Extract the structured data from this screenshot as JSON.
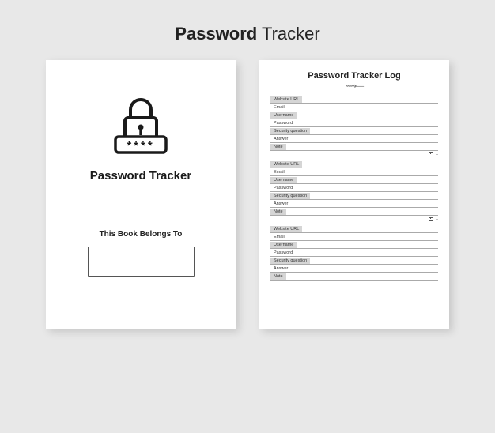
{
  "title": {
    "bold": "Password",
    "light": " Tracker"
  },
  "cover": {
    "icon_name": "padlock-password-icon",
    "title": "Password Tracker",
    "belongs_to": "This Book Belongs To"
  },
  "log": {
    "title": "Password Tracker Log",
    "swirl": "⟿—",
    "fields": [
      {
        "label": "Website URL",
        "shaded": true
      },
      {
        "label": "Email",
        "shaded": false
      },
      {
        "label": "Username",
        "shaded": true
      },
      {
        "label": "Password",
        "shaded": false
      },
      {
        "label": "Security question",
        "shaded": true
      },
      {
        "label": "Answer",
        "shaded": false
      },
      {
        "label": "Note",
        "shaded": true
      }
    ],
    "entries": 3,
    "footer_icon": "lock-icon"
  }
}
